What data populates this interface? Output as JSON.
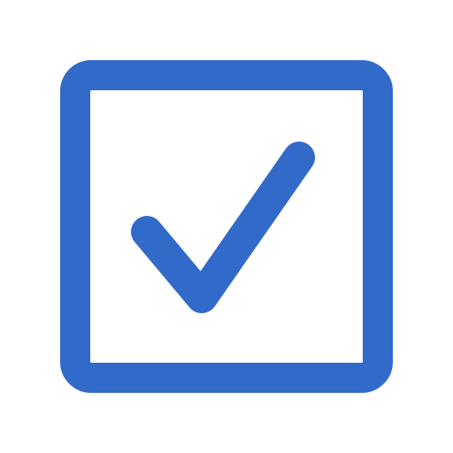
{
  "checkbox": {
    "state": "checked",
    "icon": "checkbox-checked-icon",
    "color": "#316AC8",
    "background": "#FFFFFF"
  }
}
